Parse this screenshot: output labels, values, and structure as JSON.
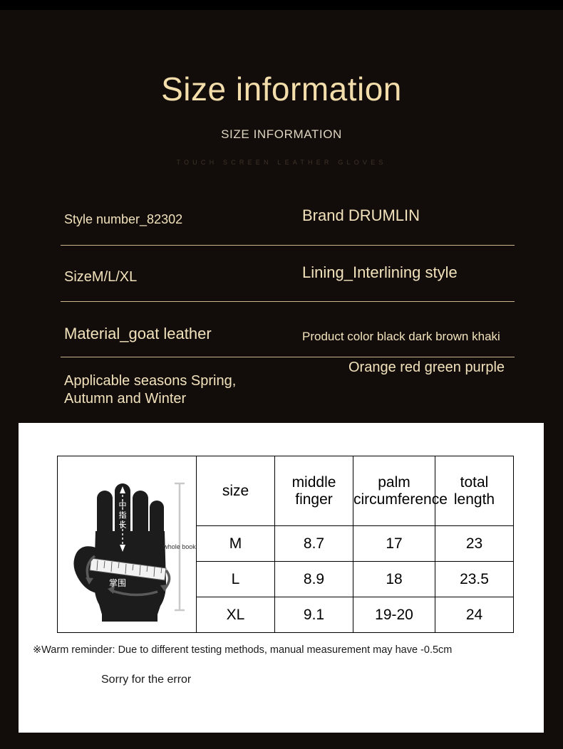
{
  "header": {
    "title": "Size information",
    "subtitle": "SIZE INFORMATION",
    "tagline": "TOUCH SCREEN LEATHER GLOVES"
  },
  "colors": {
    "background": "#120d0a",
    "top_bar": "#000000",
    "title_gold": "#f2ddab",
    "text_gold": "#f2e2bc",
    "divider_gold": "#c9b68c",
    "card_background": "#ffffff",
    "table_border": "#000000"
  },
  "specs": [
    {
      "left": "Style number_82302",
      "right": "Brand DRUMLIN"
    },
    {
      "left": "SizeM/L/XL",
      "right": "Lining_Interlining style"
    },
    {
      "left": "Material_goat leather",
      "right": "Product color black dark brown khaki"
    },
    {
      "left": "Applicable seasons Spring,\nAutumn and Winter",
      "right": "Orange red green purple"
    }
  ],
  "size_table": {
    "headers": [
      "size",
      "middle\nfinger",
      "palm\ncircumference",
      "total\nlength"
    ],
    "rows": [
      {
        "size": "M",
        "middle_finger": "8.7",
        "palm_circumference": "17",
        "total_length": "23"
      },
      {
        "size": "L",
        "middle_finger": "8.9",
        "palm_circumference": "18",
        "total_length": "23.5"
      },
      {
        "size": "XL",
        "middle_finger": "9.1",
        "palm_circumference": "19-20",
        "total_length": "24"
      }
    ]
  },
  "diagram": {
    "middle_finger_label": "中指长",
    "palm_label": "掌围",
    "total_length_label": "whole book"
  },
  "notes": {
    "warm_reminder": "※Warm reminder: Due to different testing methods, manual measurement may have -0.5cm",
    "apology": "Sorry for the error"
  }
}
